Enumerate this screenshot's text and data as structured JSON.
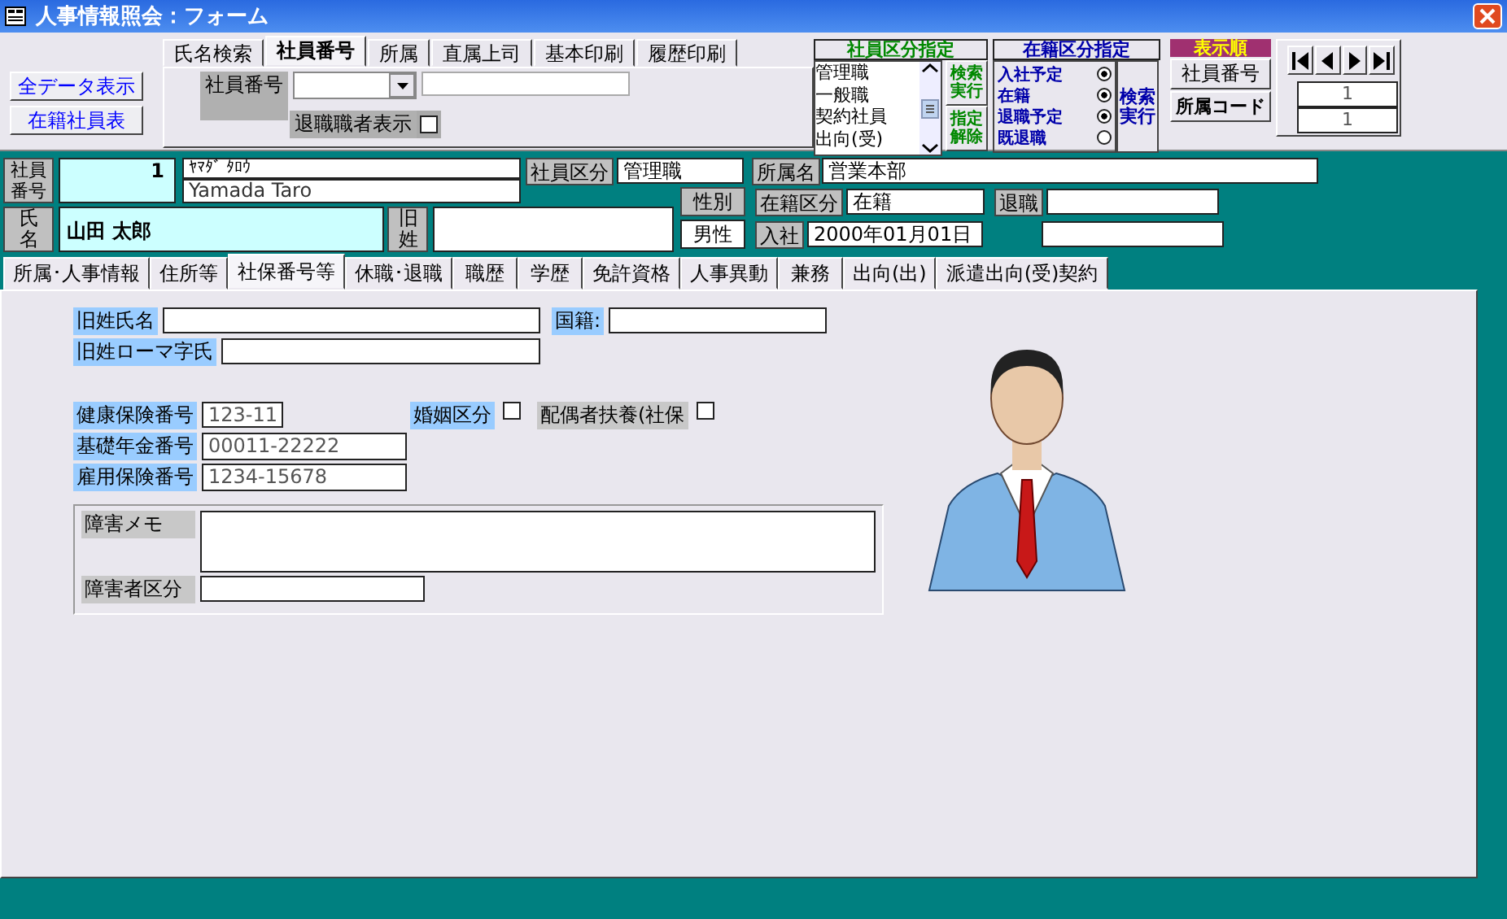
{
  "window": {
    "title": "人事情報照会：フォーム"
  },
  "side_buttons": [
    "全データ表示",
    "在籍社員表"
  ],
  "search_tabs": [
    {
      "label": "氏名検索",
      "selected": false
    },
    {
      "label": "社員番号",
      "selected": true
    },
    {
      "label": "所属",
      "selected": false
    },
    {
      "label": "直属上司",
      "selected": false
    },
    {
      "label": "基本印刷",
      "selected": false
    },
    {
      "label": "履歴印刷",
      "selected": false
    }
  ],
  "search_panel": {
    "label": "社員番号",
    "retired_label": "退職職者表示",
    "retired_checked": false
  },
  "employee_type_filter": {
    "title": "社員区分指定",
    "items": [
      "管理職",
      "一般職",
      "契約社員",
      "出向(受)"
    ],
    "buttons": [
      "検索実行",
      "指定解除"
    ]
  },
  "status_filter": {
    "title": "在籍区分指定",
    "options": [
      {
        "label": "入社予定",
        "checked": true
      },
      {
        "label": "在籍",
        "checked": true
      },
      {
        "label": "退職予定",
        "checked": true
      },
      {
        "label": "既退職",
        "checked": false
      }
    ],
    "button": "検索実行"
  },
  "sort_order": {
    "title": "表示順",
    "buttons": [
      "社員番号",
      "所属コード"
    ]
  },
  "navigator": {
    "current": "1",
    "total": "1"
  },
  "employee": {
    "number_label": "社員番号",
    "number": "1",
    "kana": "ﾔﾏﾀﾞ ﾀﾛｳ",
    "romaji": "Yamada Taro",
    "name_label": "氏名",
    "name": "山田 太郎",
    "old_surname_label": "旧姓",
    "type_label": "社員区分",
    "type": "管理職",
    "gender_label": "性別",
    "gender": "男性",
    "dept_label": "所属名",
    "dept": "営業本部",
    "status_label": "在籍区分",
    "status": "在籍",
    "retire_label": "退職",
    "join_label": "入社",
    "join_date": "2000年01月01日"
  },
  "detail_tabs": [
    {
      "label": "所属･人事情報",
      "selected": false
    },
    {
      "label": "住所等",
      "selected": false
    },
    {
      "label": "社保番号等",
      "selected": true
    },
    {
      "label": "休職･退職",
      "selected": false
    },
    {
      "label": "職歴",
      "selected": false
    },
    {
      "label": "学歴",
      "selected": false
    },
    {
      "label": "免許資格",
      "selected": false
    },
    {
      "label": "人事異動",
      "selected": false
    },
    {
      "label": "兼務",
      "selected": false
    },
    {
      "label": "出向(出)",
      "selected": false
    },
    {
      "label": "派遣出向(受)契約",
      "selected": false
    }
  ],
  "insurance": {
    "old_name_label": "旧姓氏名",
    "nationality_label": "国籍:",
    "old_name_romaji_label": "旧姓ローマ字氏",
    "health_label": "健康保険番号",
    "health": "123-11",
    "pension_label": "基礎年金番号",
    "pension": "00011-22222",
    "employment_label": "雇用保険番号",
    "employment": "1234-15678",
    "marriage_label": "婚姻区分",
    "marriage_checked": false,
    "spouse_label": "配偶者扶養(社保",
    "spouse_checked": false,
    "disability_memo_label": "障害メモ",
    "disability_type_label": "障害者区分"
  }
}
